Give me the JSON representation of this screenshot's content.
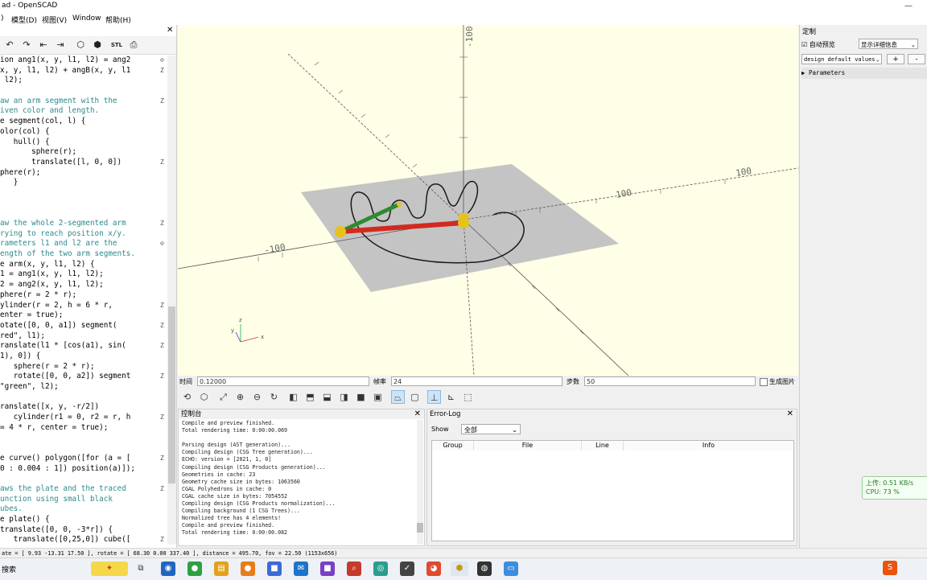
{
  "window": {
    "title": "ad - OpenSCAD"
  },
  "menu": [
    ")",
    "模型(D)",
    "视图(V)",
    "Window",
    "帮助(H)"
  ],
  "editor": {
    "lines": [
      {
        "t": "ion ang1(x, y, l1, l2) = ang2 ",
        "c": "",
        "f": "⊘"
      },
      {
        "t": "x, y, l1, l2) + angB(x, y, l1",
        "c": "",
        "f": "Z"
      },
      {
        "t": " l2);",
        "c": "",
        "f": ""
      },
      {
        "t": "",
        "c": "",
        "f": ""
      },
      {
        "t": "aw an arm segment with the",
        "c": "cmt",
        "f": "Z"
      },
      {
        "t": "iven color and length.",
        "c": "cmt",
        "f": ""
      },
      {
        "t": "e segment(col, l) {",
        "c": "",
        "f": ""
      },
      {
        "t": "olor(col) {",
        "c": "",
        "f": ""
      },
      {
        "t": "   hull() {",
        "c": "",
        "f": ""
      },
      {
        "t": "       sphere(r);",
        "c": "",
        "f": ""
      },
      {
        "t": "       translate([l, 0, 0])",
        "c": "",
        "f": "Z"
      },
      {
        "t": "phere(r);",
        "c": "",
        "f": ""
      },
      {
        "t": "   }",
        "c": "",
        "f": ""
      },
      {
        "t": "",
        "c": "",
        "f": ""
      },
      {
        "t": "",
        "c": "",
        "f": ""
      },
      {
        "t": "",
        "c": "",
        "f": ""
      },
      {
        "t": "aw the whole 2-segmented arm",
        "c": "cmt",
        "f": "Z"
      },
      {
        "t": "rying to reach position x/y.",
        "c": "cmt",
        "f": ""
      },
      {
        "t": "rameters l1 and l2 are the",
        "c": "cmt",
        "f": "⊘"
      },
      {
        "t": "ength of the two arm segments.",
        "c": "cmt",
        "f": ""
      },
      {
        "t": "e arm(x, y, l1, l2) {",
        "c": "",
        "f": ""
      },
      {
        "t": "1 = ang1(x, y, l1, l2);",
        "c": "",
        "f": ""
      },
      {
        "t": "2 = ang2(x, y, l1, l2);",
        "c": "",
        "f": ""
      },
      {
        "t": "phere(r = 2 * r);",
        "c": "",
        "f": ""
      },
      {
        "t": "ylinder(r = 2, h = 6 * r,",
        "c": "",
        "f": "Z"
      },
      {
        "t": "enter = true);",
        "c": "",
        "f": ""
      },
      {
        "t": "otate([0, 0, a1]) segment(",
        "c": "",
        "f": "Z"
      },
      {
        "t": "red\", l1);",
        "c": "",
        "f": ""
      },
      {
        "t": "ranslate(l1 * [cos(a1), sin(",
        "c": "",
        "f": "Z"
      },
      {
        "t": "1), 0]) {",
        "c": "",
        "f": ""
      },
      {
        "t": "   sphere(r = 2 * r);",
        "c": "",
        "f": ""
      },
      {
        "t": "   rotate([0, 0, a2]) segment",
        "c": "",
        "f": "Z"
      },
      {
        "t": "\"green\", l2);",
        "c": "",
        "f": ""
      },
      {
        "t": "",
        "c": "",
        "f": ""
      },
      {
        "t": "ranslate([x, y, -r/2])",
        "c": "",
        "f": ""
      },
      {
        "t": "   cylinder(r1 = 0, r2 = r, h",
        "c": "",
        "f": "Z"
      },
      {
        "t": "= 4 * r, center = true);",
        "c": "",
        "f": ""
      },
      {
        "t": "",
        "c": "",
        "f": ""
      },
      {
        "t": "",
        "c": "",
        "f": ""
      },
      {
        "t": "e curve() polygon([for (a = [",
        "c": "",
        "f": "Z"
      },
      {
        "t": "0 : 0.004 : 1]) position(a)]);",
        "c": "",
        "f": ""
      },
      {
        "t": "",
        "c": "",
        "f": ""
      },
      {
        "t": "aws the plate and the traced",
        "c": "cmt",
        "f": "Z"
      },
      {
        "t": "unction using small black",
        "c": "cmt",
        "f": ""
      },
      {
        "t": "ubes.",
        "c": "cmt",
        "f": ""
      },
      {
        "t": "e plate() {",
        "c": "",
        "f": ""
      },
      {
        "t": "translate([0, 0, -3*r]) {",
        "c": "",
        "f": ""
      },
      {
        "t": "   translate([0,25,0]) cube([",
        "c": "",
        "f": "Z"
      }
    ]
  },
  "viewport": {
    "axis_labels": [
      "-100",
      "100",
      "100",
      "-100"
    ],
    "axis_widget": {
      "x": "x",
      "y": "y",
      "z": "z"
    },
    "colors": {
      "background": "#fffee6",
      "plate": "#c4c4c4",
      "arm1": "#d22a1e",
      "arm2": "#2e8b2e",
      "joint": "#e6c21b"
    }
  },
  "animation": {
    "time_label": "时间",
    "time_value": "0.12000",
    "fps_label": "帧率",
    "fps_value": "24",
    "steps_label": "步数",
    "steps_value": "50",
    "dump_label": "生成图片"
  },
  "console": {
    "title": "控制台",
    "lines": [
      "Compile and preview finished.",
      "Total rendering time: 0:00:00.069",
      "",
      "Parsing design (AST generation)...",
      "Compiling design (CSG Tree generation)...",
      "ECHO: version = [2021, 1, 0]",
      "Compiling design (CSG Products generation)...",
      "Geometries in cache: 23",
      "Geometry cache size in bytes: 1063560",
      "CGAL Polyhedrons in cache: 0",
      "CGAL cache size in bytes: 7054552",
      "Compiling design (CSG Products normalization)...",
      "Compiling background (1 CSG Trees)...",
      "Normalized tree has 4 elements!",
      "Compile and preview finished.",
      "Total rendering time: 0:00:00.082"
    ]
  },
  "errorlog": {
    "title": "Error-Log",
    "show_label": "Show",
    "show_value": "全部",
    "columns": [
      "Group",
      "File",
      "Line",
      "Info"
    ]
  },
  "customizer": {
    "title": "定制",
    "auto_preview": "自动预览",
    "detail": "显示详细信息",
    "preset": "design default values",
    "add": "+",
    "remove": "-",
    "params": "Parameters"
  },
  "network": {
    "up": "上传: 0.51 KB/s",
    "cpu": "CPU: 73 %"
  },
  "statusbar": {
    "text": "ate = [ 9.93 -13.31 17.50 ], rotate = [ 68.30 0.00 337.40 ], distance = 495.70, fov = 22.50 (1153x656)"
  },
  "taskbar": {
    "search": "搜索"
  }
}
